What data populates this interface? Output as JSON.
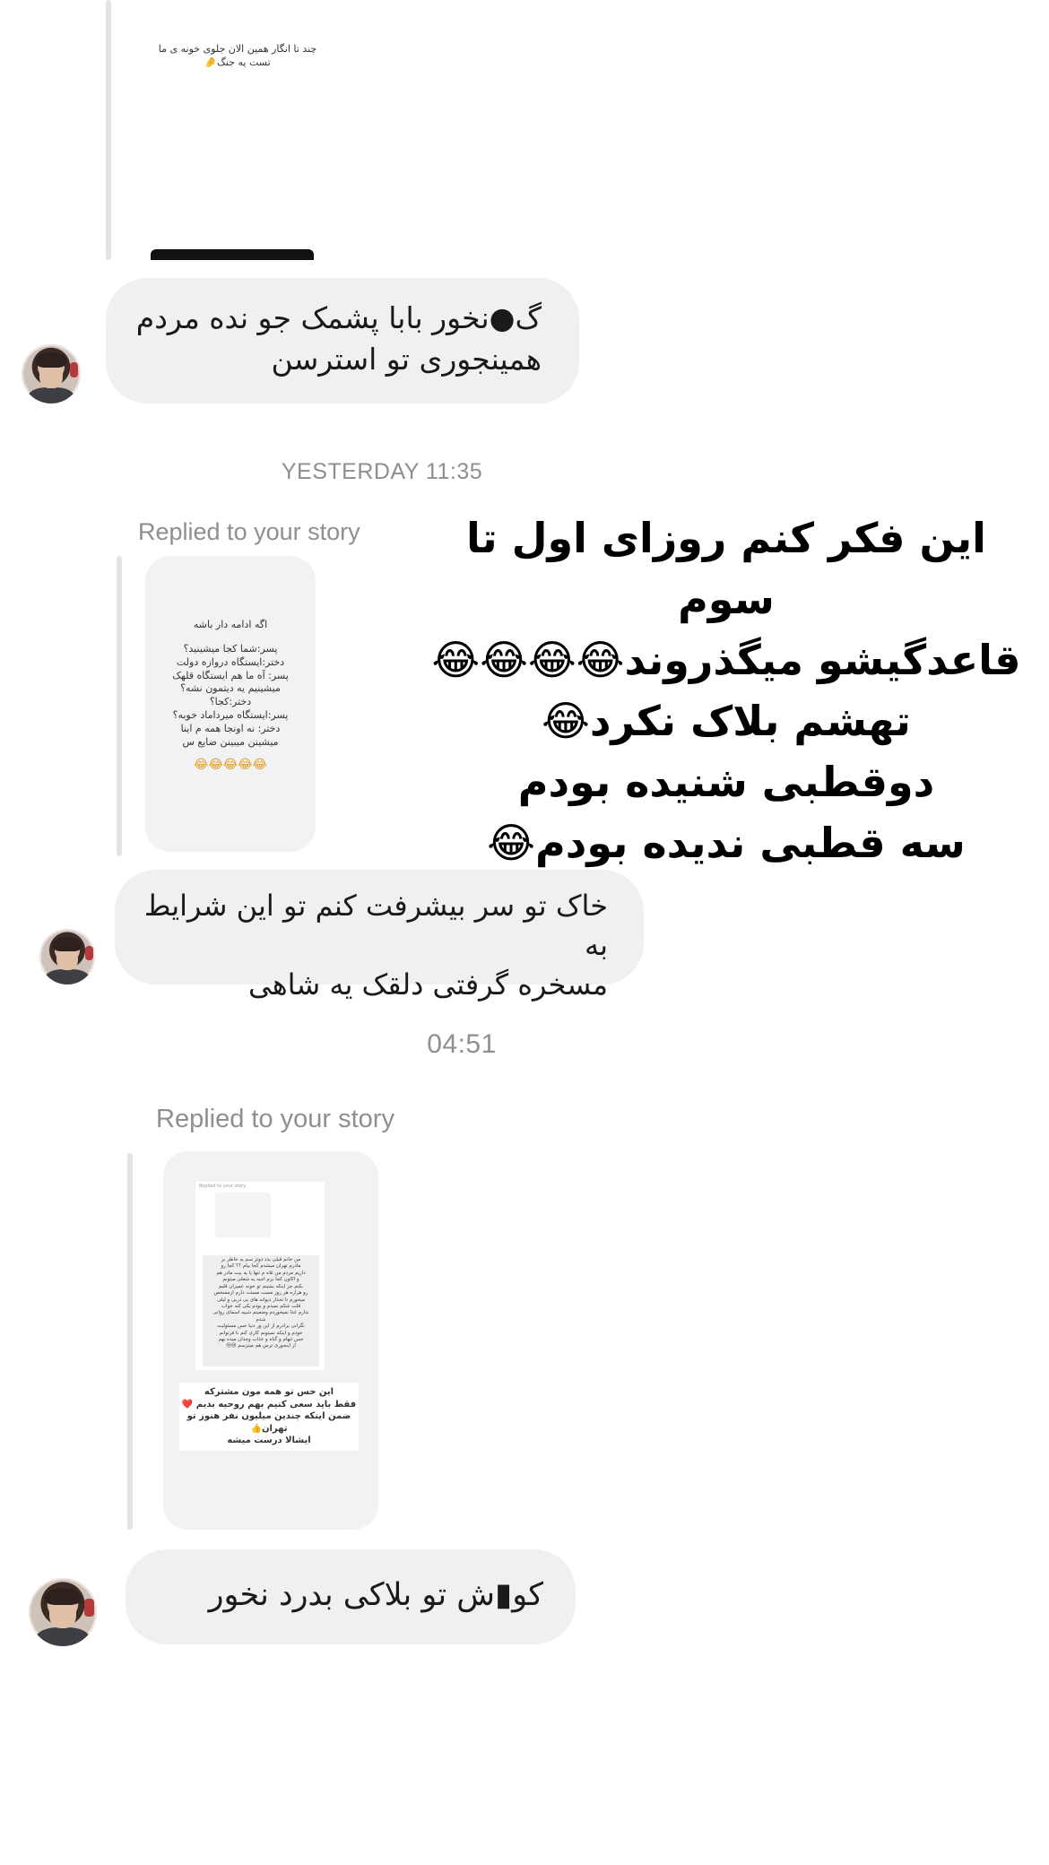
{
  "messages": [
    {
      "text_lines": [
        "گ●نخور بابا پشمک جو نده مردم",
        "همینجوری تو استرسن"
      ]
    },
    {
      "text_lines": [
        "خاک تو سر بیشرفت کنم تو این شرایط به",
        "مسخره گرفتی دلقک یه شاهی"
      ]
    },
    {
      "text_lines": [
        "کو▮ش تو بلاکی بدرد نخور"
      ]
    }
  ],
  "timestamps": {
    "yesterday": "YESTERDAY 11:35",
    "today": "04:51"
  },
  "story_replies": {
    "first_label": "Replied to your story",
    "second_label": "Replied to your story"
  },
  "story_top": {
    "text_lines": [
      "چند تا انگار همین الان جلوی خونه ی ما",
      "تست یه جنگ🤌"
    ]
  },
  "story_first": {
    "title": "اگه ادامه دار باشه",
    "body_lines": [
      "پسر:شما کجا میشینید؟",
      "دختر:ایستگاه دروازه دولت",
      "پسر: آه ما هم ایستگاه قلهک",
      "میشینیم یه دیتمون نشه؟",
      "دختر:کجا؟",
      "پسر:ایستگاه میرداماد خوبه؟",
      "دختر: نه اونجا همه م اینا",
      "میشینن میبینن ضایع س"
    ],
    "emojis": "😂😂😂😂😂"
  },
  "story_second": {
    "header": "Replied to your story",
    "inner_lines": [
      "من خانم قبلی بدد دوتز سم یه خاطر بر",
      "مادرم تهران میشدم کجا بیام ؟؟ کجا رو",
      "داریم مردم من تلاه م تنها یا یه بیت مادر هم",
      "و اکاون کجا برم اجیه یه شغلی میتونم",
      "بکنم جز اینکه بشینم تو خونه عمیران قلیم",
      "رو هزاره هر روز مست مستت دارم ازمسخص",
      "میخورم تا تحذار دیوانه های بی دربی و لیلی",
      "قلب شکم نمیدم و بودم یکی کنه خواب",
      "ندارم غذا نمیخوردم وضعیتم شبیه اسمای روانی",
      "شدم",
      "نگرانی برادرم از این ور دنیا حس مسئولیت",
      "خودم و اینکه نمیتونم کاری کنم نا فرتوانم",
      "حس تنهام و گناه و عذاب وجدان میده بهم",
      "از اینجوری ترس هم مینزسم 😢😢"
    ],
    "caption_lines": [
      "این حس تو همه مون مشترکه",
      "فقط باید سعی کنیم بهم روحیه بدیم ❤️",
      "ضمن اینکه چندین میلیون نفر هنوز تو تهران👍",
      "ایشالا درست میشه"
    ]
  },
  "overlay_text": {
    "lines": [
      "این فکر کنم روزای اول تا سوم",
      "قاعدگیشو میگذروند😂😂😂😂",
      "تهشم بلاک نکرد😂",
      "دوقطبی شنیده بودم",
      "سه قطبی ندیده بودم😂"
    ]
  },
  "colors": {
    "bubble": "#f0f0f3",
    "timestamp": "#8e8e93",
    "story_card": "#f2f2f4",
    "reply_line": "#e3e3e6"
  }
}
